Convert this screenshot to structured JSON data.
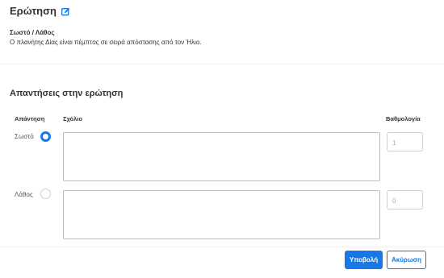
{
  "question": {
    "title": "Ερώτηση",
    "edit_icon": "edit-icon",
    "type": "Σωστό / Λάθος",
    "text": "Ο πλανήτης Δίας είναι πέμπτος σε σειρά απόστασης από τον Ήλιο."
  },
  "answers": {
    "section_title": "Απαντήσεις στην ερώτηση",
    "headers": {
      "answer": "Απάντηση",
      "comment": "Σχόλιο",
      "score": "Βαθμολογία"
    },
    "rows": [
      {
        "label": "Σωστό",
        "selected": true,
        "comment": "",
        "score": "1"
      },
      {
        "label": "Λάθος",
        "selected": false,
        "comment": "",
        "score": "0"
      }
    ]
  },
  "actions": {
    "submit_label": "Υποβολή",
    "cancel_label": "Ακύρωση"
  },
  "colors": {
    "accent": "#1677e5"
  }
}
